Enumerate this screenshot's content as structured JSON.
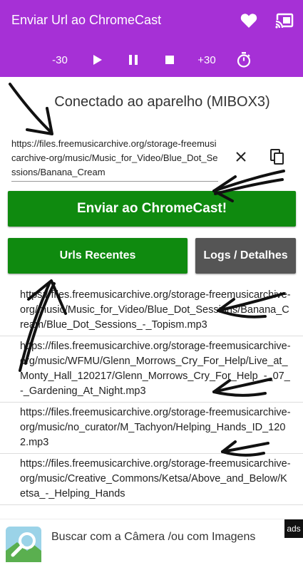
{
  "app": {
    "title": "Enviar Url ao ChromeCast"
  },
  "topbar": {
    "icons": [
      "heart-icon",
      "cast-icon"
    ]
  },
  "controls": {
    "rewind_label": "-30",
    "forward_label": "+30",
    "icons": [
      "play-icon",
      "pause-icon",
      "stop-icon",
      "timer-icon"
    ]
  },
  "status": {
    "text": "Conectado ao aparelho (MIBOX3)"
  },
  "url_input": {
    "value": "https://files.freemusicarchive.org/storage-freemusicarchive-org/music/Music_for_Video/Blue_Dot_Sessions/Banana_Cream"
  },
  "actions": {
    "send_label": "Enviar ao ChromeCast!",
    "recent_label": "Urls Recentes",
    "logs_label": "Logs / Detalhes"
  },
  "recent_urls": [
    "https://files.freemusicarchive.org/storage-freemusicarchive-org/music/Music_for_Video/Blue_Dot_Sessions/Banana_Cream/Blue_Dot_Sessions_-_Topism.mp3",
    "https://files.freemusicarchive.org/storage-freemusicarchive-org/music/WFMU/Glenn_Morrows_Cry_For_Help/Live_at_Monty_Hall_120217/Glenn_Morrows_Cry_For_Help_-_07_-_Gardening_At_Night.mp3",
    "https://files.freemusicarchive.org/storage-freemusicarchive-org/music/no_curator/M_Tachyon/Helping_Hands_ID_1202.mp3",
    "https://files.freemusicarchive.org/storage-freemusicarchive-org/music/Creative_Commons/Ketsa/Above_and_Below/Ketsa_-_Helping_Hands"
  ],
  "ad": {
    "text": "Buscar com a Câmera /ou com Imagens",
    "badge": "ads"
  },
  "colors": {
    "appbar": "#a630d6",
    "send_button": "#0f8a0f",
    "logs_button": "#555555"
  }
}
